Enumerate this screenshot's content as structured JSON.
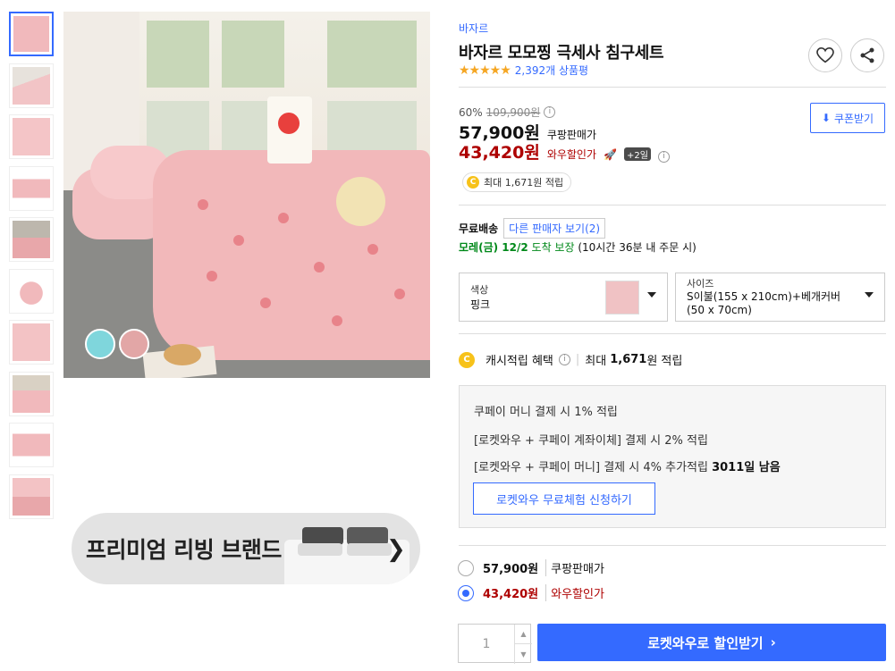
{
  "product": {
    "brand": "바자르",
    "title": "바자르 모모찡 극세사 침구세트",
    "rating_stars": "★★★★★",
    "review_count": "2,392개 상품평"
  },
  "pricing": {
    "discount_rate": "60%",
    "original_price": "109,900원",
    "sale_price": "57,900원",
    "sale_label": "쿠팡판매가",
    "member_price": "43,420원",
    "member_label": "와우할인가",
    "member_badge": "+2일",
    "coupon_button": "쿠폰받기",
    "cashback_badge": "최대 1,671원 적립"
  },
  "shipping": {
    "label": "무료배송",
    "other_sellers": "다른 판매자 보기(2)",
    "delivery_date": "모레(금) 12/2",
    "delivery_guarantee": "도착 보장",
    "delivery_condition": "(10시간 36분 내 주문 시)"
  },
  "options": {
    "color_label": "색상",
    "color_value": "핑크",
    "size_label": "사이즈",
    "size_value": "S이불(155 x 210cm)+베개커버(50 x 70cm)"
  },
  "cash_benefit": {
    "label": "캐시적립 혜택",
    "max_prefix": "최대",
    "max_amount": "1,671",
    "max_suffix": "원 적립"
  },
  "coupay_box": {
    "line1": "쿠페이 머니 결제 시 1% 적립",
    "line2": "[로켓와우 + 쿠페이 계좌이체] 결제 시 2% 적립",
    "line3_prefix": "[로켓와우 + 쿠페이 머니] 결제 시 4% 추가적립",
    "line3_bold": "3011일 남음",
    "trial_button": "로켓와우 무료체험 신청하기"
  },
  "price_options": [
    {
      "price": "57,900원",
      "label": "쿠팡판매가",
      "selected": false
    },
    {
      "price": "43,420원",
      "label": "와우할인가",
      "selected": true
    }
  ],
  "purchase": {
    "quantity": "1",
    "buy_button": "로켓와우로 할인받기"
  },
  "banner": {
    "text": "프리미엄 리빙 브랜드"
  },
  "colors": {
    "accent": "#346aff",
    "price_red": "#ae0000",
    "delivery_green": "#00891a"
  }
}
